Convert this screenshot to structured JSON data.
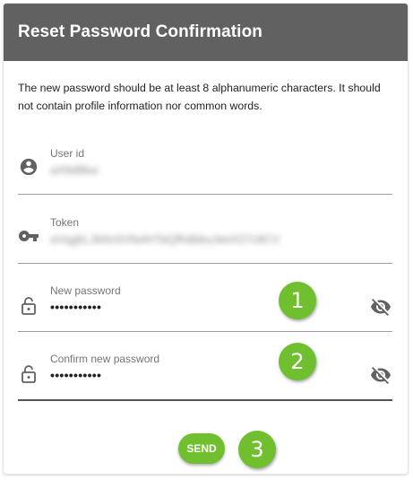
{
  "header": {
    "title": "Reset Password Confirmation"
  },
  "description": "The new password should be at least 8 alphanumeric characters. It should not contain profile information nor common words.",
  "fields": [
    {
      "label": "User id",
      "value": "aX9d8kw",
      "icon": "account-circle-icon"
    },
    {
      "label": "Token",
      "value": "aVqgkLJb0oSVfa4HTaQfhdbbuJeeX27c8CV",
      "icon": "key-icon"
    },
    {
      "label": "New password",
      "value": "•••••••••••",
      "icon": "lock-open-icon",
      "toggle": "visibility-off-icon"
    },
    {
      "label": "Confirm new password",
      "value": "•••••••••••",
      "icon": "lock-open-icon",
      "toggle": "visibility-off-icon"
    }
  ],
  "send_label": "SEND",
  "badges": [
    "1",
    "2",
    "3"
  ],
  "colors": {
    "header_bg": "#616161",
    "accent_green": "#6fbf2f",
    "icon_gray": "#616161"
  }
}
